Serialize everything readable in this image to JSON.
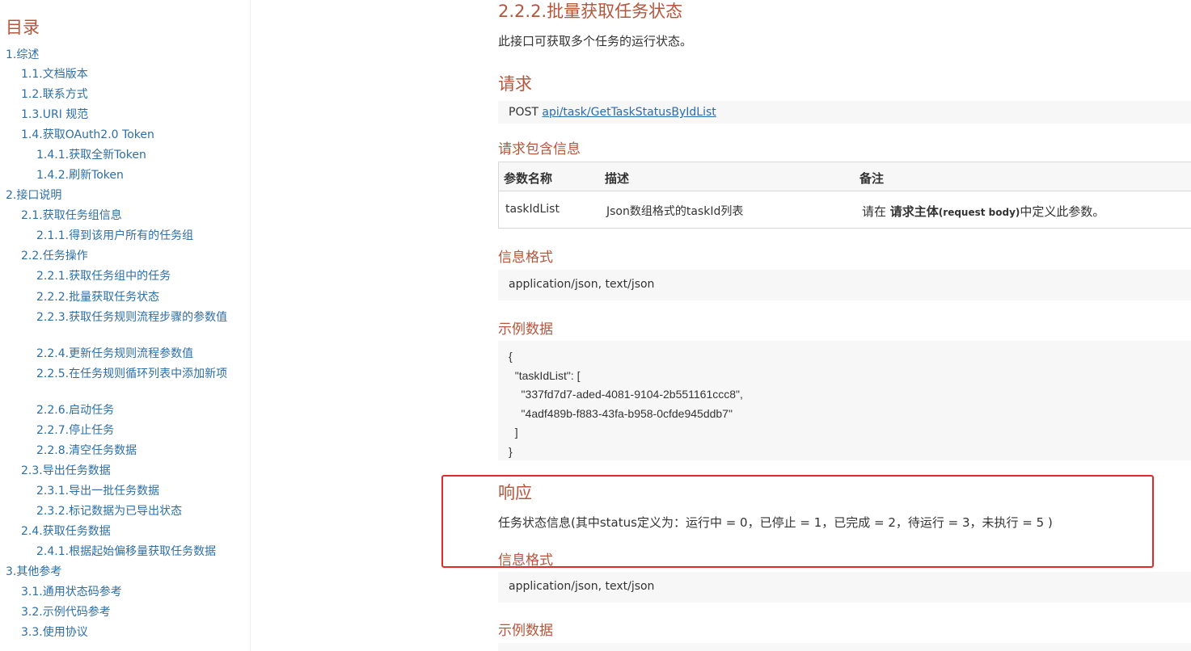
{
  "toc": {
    "title": "目录",
    "items": [
      {
        "label": "1.综述"
      },
      {
        "label": "1.1.文档版本"
      },
      {
        "label": "1.2.联系方式"
      },
      {
        "label": "1.3.URI 规范"
      },
      {
        "label": "1.4.获取OAuth2.0 Token"
      },
      {
        "label": "1.4.1.获取全新Token"
      },
      {
        "label": "1.4.2.刷新Token"
      },
      {
        "label": "2.接口说明"
      },
      {
        "label": "2.1.获取任务组信息"
      },
      {
        "label": "2.1.1.得到该用户所有的任务组"
      },
      {
        "label": "2.2.任务操作"
      },
      {
        "label": "2.2.1.获取任务组中的任务"
      },
      {
        "label": "2.2.2.批量获取任务状态"
      },
      {
        "label": "2.2.3.获取任务规则流程步骤的参数值"
      },
      {
        "label": "2.2.4.更新任务规则流程参数值"
      },
      {
        "label": "2.2.5.在任务规则循环列表中添加新项"
      },
      {
        "label": "2.2.6.启动任务"
      },
      {
        "label": "2.2.7.停止任务"
      },
      {
        "label": "2.2.8.清空任务数据"
      },
      {
        "label": "2.3.导出任务数据"
      },
      {
        "label": "2.3.1.导出一批任务数据"
      },
      {
        "label": "2.3.2.标记数据为已导出状态"
      },
      {
        "label": "2.4.获取任务数据"
      },
      {
        "label": "2.4.1.根据起始偏移量获取任务数据"
      },
      {
        "label": "3.其他参考"
      },
      {
        "label": "3.1.通用状态码参考"
      },
      {
        "label": "3.2.示例代码参考"
      },
      {
        "label": "3.3.使用协议"
      }
    ]
  },
  "content": {
    "section_title": "2.2.2.批量获取任务状态",
    "section_desc": "此接口可获取多个任务的运行状态。",
    "request": {
      "title": "请求",
      "method": "POST",
      "endpoint": "api/task/GetTaskStatusByIdList",
      "includes_title": "请求包含信息",
      "table": {
        "headers": [
          "参数名称",
          "描述",
          "备注"
        ],
        "row": {
          "name": "taskIdList",
          "desc": "Json数组格式的taskId列表",
          "note_prefix": "请在 ",
          "note_bold": "请求主体",
          "note_small": "(request body)",
          "note_suffix": "中定义此参数。"
        }
      },
      "format_title": "信息格式",
      "format_value": "application/json, text/json",
      "example_title": "示例数据",
      "example_code": "{\n  \"taskIdList\": [\n    \"337fd7d7-aded-4081-9104-2b551161ccc8\",\n    \"4adf489b-f883-43fa-b958-0cfde945ddb7\"\n  ]\n}"
    },
    "response": {
      "title": "响应",
      "desc": "任务状态信息(其中status定义为：运行中 = 0，已停止 = 1，已完成 = 2，待运行 = 3，未执行 = 5 )",
      "format_title": "信息格式",
      "format_value": "application/json, text/json",
      "example_title": "示例数据"
    }
  },
  "colors": {
    "heading": "#b5553b",
    "link": "#2d6ea6",
    "highlight": "#e32a2a",
    "block_bg": "#f7f7f7"
  }
}
